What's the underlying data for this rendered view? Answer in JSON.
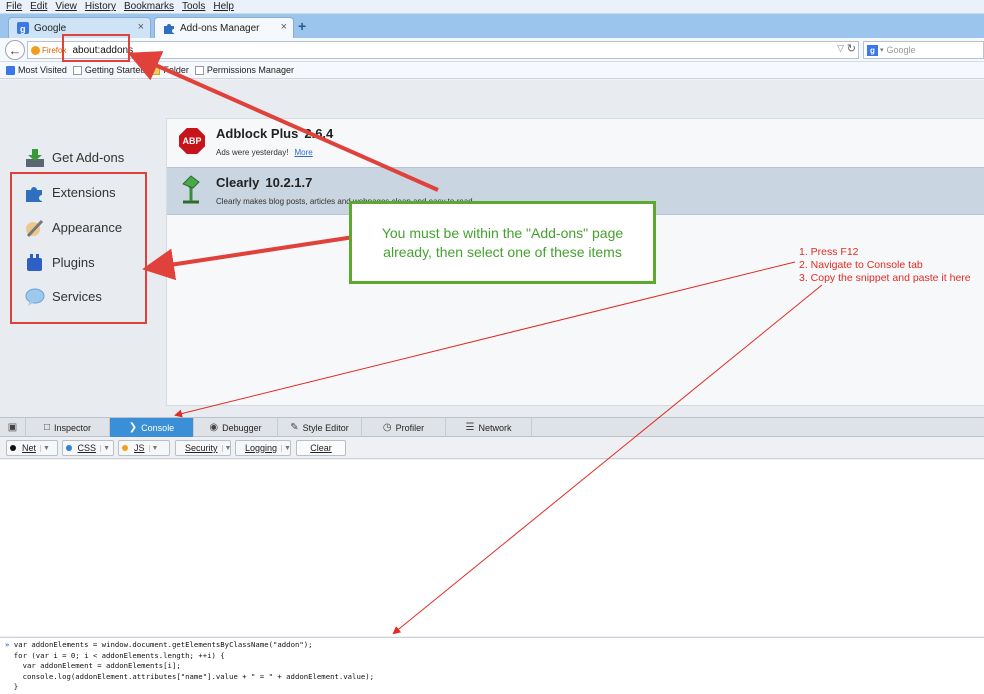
{
  "menu": [
    "File",
    "Edit",
    "View",
    "History",
    "Bookmarks",
    "Tools",
    "Help"
  ],
  "tabs": {
    "google": "Google",
    "addons": "Add-ons Manager",
    "close": "×",
    "new": "+"
  },
  "navbar": {
    "identity": "Firefox",
    "url": "about:addons",
    "search_placeholder": "Google"
  },
  "bookmarks": [
    "Most Visited",
    "Getting Started",
    "Folder",
    "Permissions Manager"
  ],
  "categories": [
    "Get Add-ons",
    "Extensions",
    "Appearance",
    "Plugins",
    "Services"
  ],
  "addons": [
    {
      "name": "Adblock Plus",
      "version": "2.6.4",
      "description": "Ads were yesterday!",
      "more": "More"
    },
    {
      "name": "Clearly",
      "version": "10.2.1.7",
      "description": "Clearly makes blog posts, articles and webpages clean and easy to read"
    }
  ],
  "devtools": {
    "tabs": [
      "Inspector",
      "Console",
      "Debugger",
      "Style Editor",
      "Profiler",
      "Network"
    ],
    "filters": [
      "Net",
      "CSS",
      "JS",
      "Security",
      "Logging"
    ],
    "clear": "Clear",
    "console_input": [
      "var addonElements = window.document.getElementsByClassName(\"addon\");",
      "  for (var i = 0; i < addonElements.length; ++i) {",
      "    var addonElement = addonElements[i];",
      "    console.log(addonElement.attributes[\"name\"].value + \" = \" + addonElement.value);",
      "  }"
    ]
  },
  "annotations": {
    "callout": "You must be within the \"Add-ons\" page already, then select one of these items",
    "steps": [
      "1. Press F12",
      "2. Navigate to Console tab",
      "3. Copy the snippet and paste it here"
    ]
  },
  "colors": {
    "annotation_red": "#e0413a",
    "callout_green": "#5da82f",
    "console_tab_blue": "#3a8fd6"
  }
}
